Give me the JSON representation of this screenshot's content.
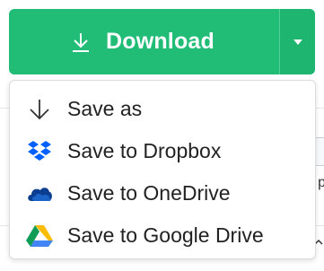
{
  "download": {
    "label": "Download",
    "icon": "download-arrow-icon",
    "caret_icon": "chevron-down-icon",
    "accent_color": "#21bd77"
  },
  "menu": {
    "items": [
      {
        "label": "Save as",
        "icon": "arrow-down-icon"
      },
      {
        "label": "Save to Dropbox",
        "icon": "dropbox-icon"
      },
      {
        "label": "Save to OneDrive",
        "icon": "onedrive-icon"
      },
      {
        "label": "Save to Google Drive",
        "icon": "google-drive-icon"
      }
    ]
  },
  "background": {
    "fragment_text": "p"
  }
}
